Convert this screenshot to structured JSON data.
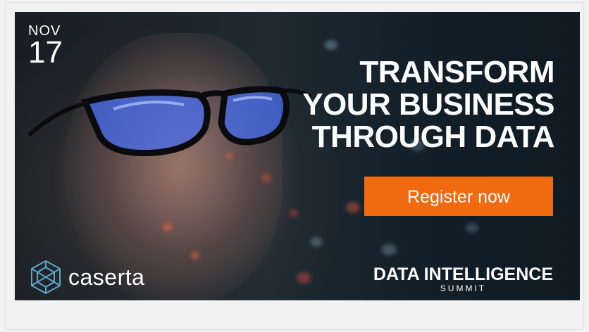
{
  "banner": {
    "date": {
      "month": "NOV",
      "day": "17"
    },
    "headline": [
      "TRANSFORM",
      "YOUR BUSINESS",
      "THROUGH DATA"
    ],
    "cta_label": "Register now",
    "brand": {
      "name": "caserta",
      "icon": "geodesic-sphere-icon"
    },
    "event": {
      "title": "DATA INTELLIGENCE",
      "subtitle": "SUMMIT"
    },
    "colors": {
      "cta": "#f26a0f",
      "text": "#ffffff",
      "background": "#141c22",
      "logo_icon": "#5aa7c8"
    }
  }
}
